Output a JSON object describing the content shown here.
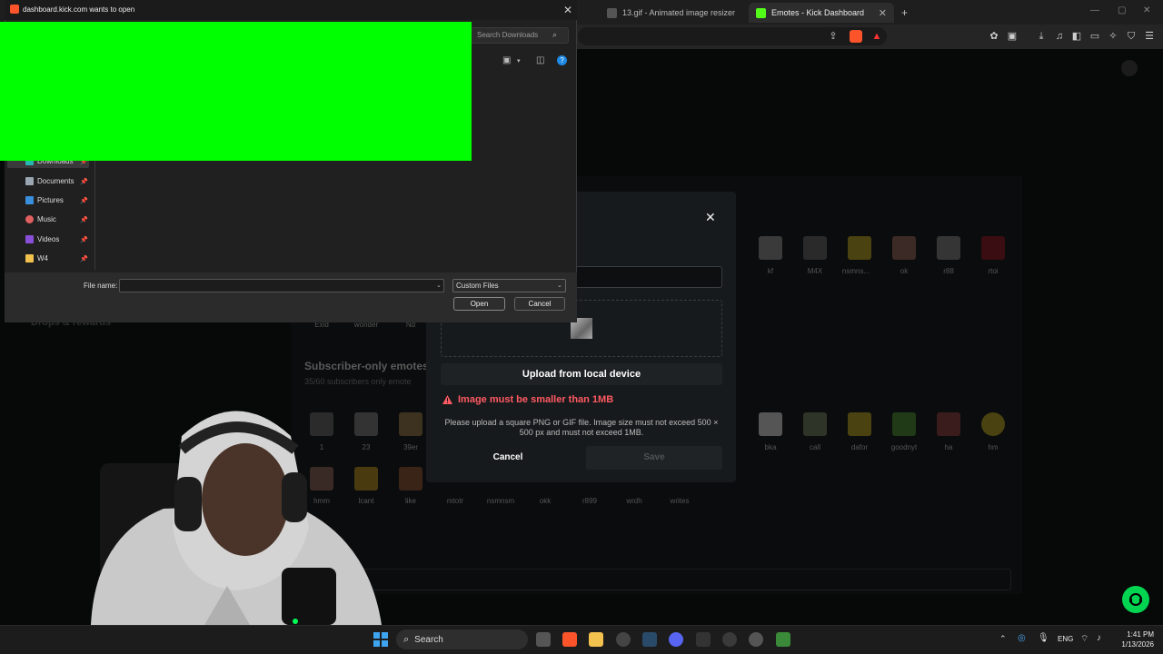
{
  "browser": {
    "tabs": [
      {
        "label": "13.gif - Animated image resizer",
        "active": false
      },
      {
        "label": "Emotes - Kick Dashboard",
        "active": true
      }
    ],
    "new_tab": "+"
  },
  "dashboard": {
    "drops_label": "Drops & rewards",
    "subscriber_section": {
      "title": "Subscriber-only emotes",
      "count": "35/60 subscribers only emote"
    },
    "top_emotes": [
      "kf",
      "M4X",
      "nsmns...",
      "ok",
      "r88",
      "rtoi"
    ],
    "top_emotes_mid": [
      "Exid",
      "wonder",
      "Nd"
    ],
    "sub_emotes_row1": [
      "1",
      "23",
      "39er",
      "bka",
      "call",
      "dafor",
      "goodnyt",
      "ha",
      "hm"
    ],
    "sub_emotes_row2": [
      "hmm",
      "lcant",
      "like",
      "mtotr",
      "nsmnsm",
      "okk",
      "r899",
      "wrdh",
      "writes"
    ]
  },
  "modal": {
    "close_icon": "close-icon",
    "upload_label": "Upload from local device",
    "error": "Image must be smaller than 1MB",
    "help": "Please upload a square PNG or GIF file. Image size must not exceed 500 × 500 px and must not exceed 1MB.",
    "cancel_label": "Cancel",
    "save_label": "Save"
  },
  "file_dialog": {
    "title": "dashboard.kick.com wants to open",
    "search_placeholder": "Search Downloads",
    "nav_items": [
      "Downloads",
      "Documents",
      "Pictures",
      "Music",
      "Videos",
      "W4"
    ],
    "file_name_label": "File name:",
    "file_type": "Custom Files",
    "open_label": "Open",
    "cancel_label": "Cancel"
  },
  "taskbar": {
    "search_label": "Search",
    "language": "ENG",
    "time": "1:41 PM",
    "date": "1/13/2026"
  },
  "colors": {
    "kick_green": "#00d451",
    "error_red": "#ff5a63",
    "green_screen": "#00ff00"
  }
}
